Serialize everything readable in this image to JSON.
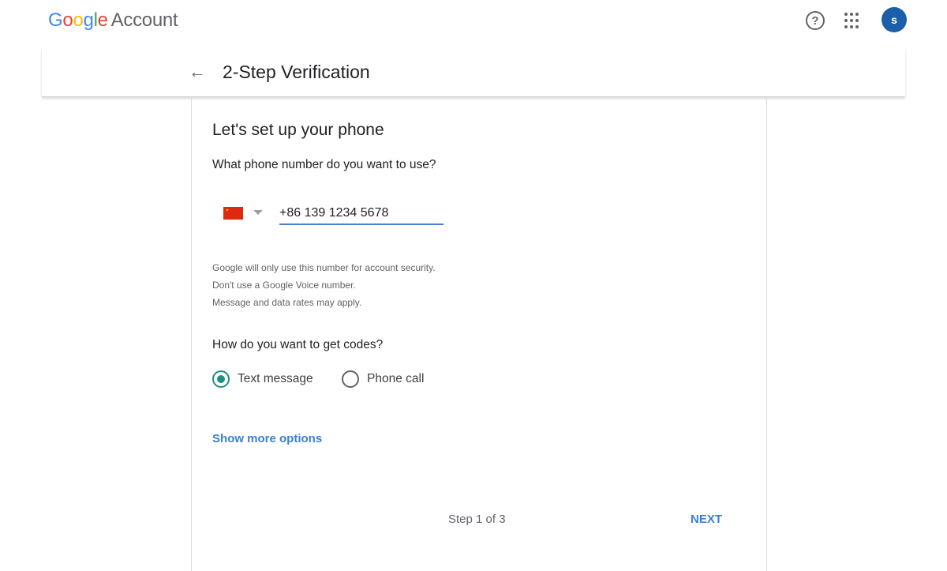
{
  "header": {
    "logo_letters": [
      "G",
      "o",
      "o",
      "g",
      "l",
      "e"
    ],
    "logo_colors": [
      "#4285f4",
      "#ea4335",
      "#fbbc05",
      "#4285f4",
      "#34a853",
      "#ea4335"
    ],
    "product": "Account",
    "help_icon": "?",
    "avatar_initial": "s"
  },
  "subheader": {
    "back_icon": "←",
    "title": "2-Step Verification"
  },
  "card": {
    "heading": "Let's set up your phone",
    "question": "What phone number do you want to use?",
    "country": "China",
    "phone_value": "+86 139 1234 5678",
    "notes": [
      "Google will only use this number for account security.",
      "Don't use a Google Voice number.",
      "Message and data rates may apply."
    ],
    "codes_question": "How do you want to get codes?",
    "options": [
      {
        "label": "Text message",
        "selected": true
      },
      {
        "label": "Phone call",
        "selected": false
      }
    ],
    "show_more": "Show more options",
    "step": "Step 1 of 3",
    "next": "NEXT"
  },
  "colors": {
    "accent": "#3a7fd5",
    "radio": "#1e8e7e",
    "avatar": "#1a5fa8"
  }
}
